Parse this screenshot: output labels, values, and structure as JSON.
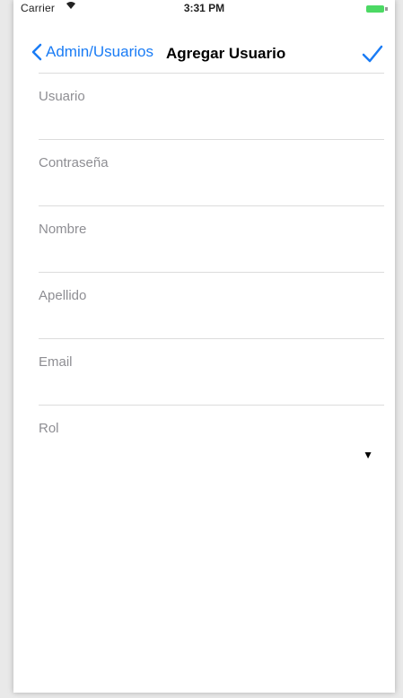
{
  "status_bar": {
    "carrier": "Carrier",
    "time": "3:31 PM"
  },
  "nav": {
    "back_label": "Admin/Usuarios",
    "title": "Agregar Usuario",
    "done_icon": "checkmark-icon"
  },
  "form": {
    "fields": [
      {
        "label": "Usuario",
        "value": ""
      },
      {
        "label": "Contraseña",
        "value": ""
      },
      {
        "label": "Nombre",
        "value": ""
      },
      {
        "label": "Apellido",
        "value": ""
      },
      {
        "label": "Email",
        "value": ""
      }
    ],
    "role": {
      "label": "Rol",
      "value": "",
      "arrow_icon": "dropdown-arrow-icon"
    }
  },
  "colors": {
    "accent": "#1a7cf5",
    "label": "#8e8e93",
    "divider": "#dcdcdc"
  }
}
